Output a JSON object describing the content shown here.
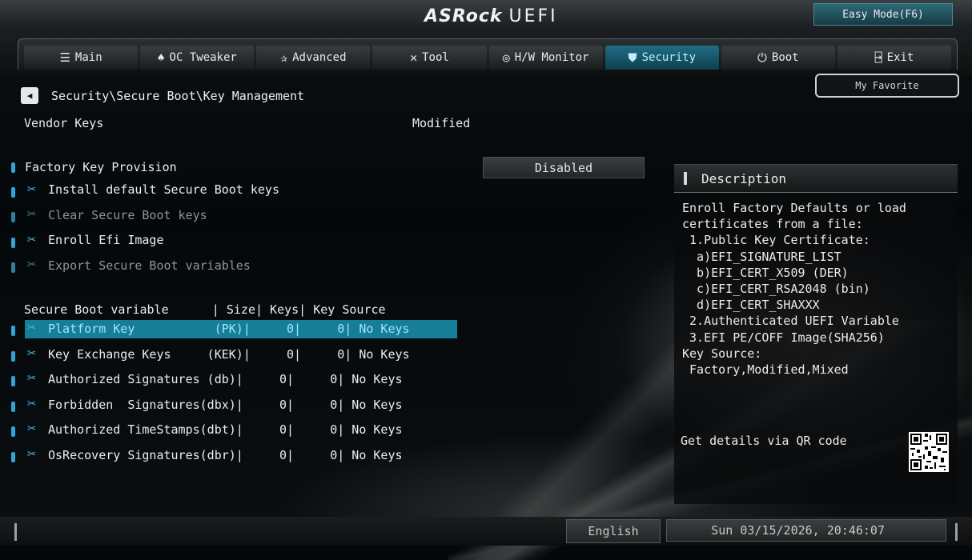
{
  "header": {
    "brand": "ASRock",
    "product": "UEFI",
    "easy_mode": "Easy Mode(F6)",
    "my_favorite": "My Favorite"
  },
  "tabs": [
    {
      "label": "Main",
      "icon": "list-icon",
      "active": false
    },
    {
      "label": "OC Tweaker",
      "icon": "rocket-icon",
      "active": false
    },
    {
      "label": "Advanced",
      "icon": "star-icon",
      "active": false
    },
    {
      "label": "Tool",
      "icon": "wrench-icon",
      "active": false
    },
    {
      "label": "H/W Monitor",
      "icon": "gauge-icon",
      "active": false
    },
    {
      "label": "Security",
      "icon": "shield-icon",
      "active": true
    },
    {
      "label": "Boot",
      "icon": "power-icon",
      "active": false
    },
    {
      "label": "Exit",
      "icon": "exit-icon",
      "active": false
    }
  ],
  "breadcrumb": "Security\\Secure Boot\\Key Management",
  "vendor_keys": {
    "label": "Vendor Keys",
    "value": "Modified"
  },
  "factory_key": {
    "label": "Factory Key Provision",
    "value": "Disabled"
  },
  "actions": [
    {
      "label": "Install default Secure Boot keys",
      "enabled": true
    },
    {
      "label": "Clear Secure Boot keys",
      "enabled": false
    },
    {
      "label": "Enroll Efi Image",
      "enabled": true
    },
    {
      "label": "Export Secure Boot variables",
      "enabled": false
    }
  ],
  "table_header": "Secure Boot variable      | Size| Keys| Key Source",
  "variables": [
    {
      "text": "Platform Key           (PK)|     0|     0| No Keys",
      "selected": true
    },
    {
      "text": "Key Exchange Keys     (KEK)|     0|     0| No Keys",
      "selected": false
    },
    {
      "text": "Authorized Signatures (db)|     0|     0| No Keys",
      "selected": false
    },
    {
      "text": "Forbidden  Signatures(dbx)|     0|     0| No Keys",
      "selected": false
    },
    {
      "text": "Authorized TimeStamps(dbt)|     0|     0| No Keys",
      "selected": false
    },
    {
      "text": "OsRecovery Signatures(dbr)|     0|     0| No Keys",
      "selected": false
    }
  ],
  "description": {
    "title": "Description",
    "body": "Enroll Factory Defaults or load\ncertificates from a file:\n 1.Public Key Certificate:\n  a)EFI_SIGNATURE_LIST\n  b)EFI_CERT_X509 (DER)\n  c)EFI_CERT_RSA2048 (bin)\n  d)EFI_CERT_SHAXXX\n 2.Authenticated UEFI Variable\n 3.EFI PE/COFF Image(SHA256)\nKey Source:\n Factory,Modified,Mixed",
    "qr_text": "Get details via QR code"
  },
  "footer": {
    "language": "English",
    "datetime": "Sun 03/15/2026, 20:46:07"
  },
  "colors": {
    "accent": "#167e96",
    "wrench": "#3fb5e8",
    "active_tab": "#1f6e86"
  }
}
